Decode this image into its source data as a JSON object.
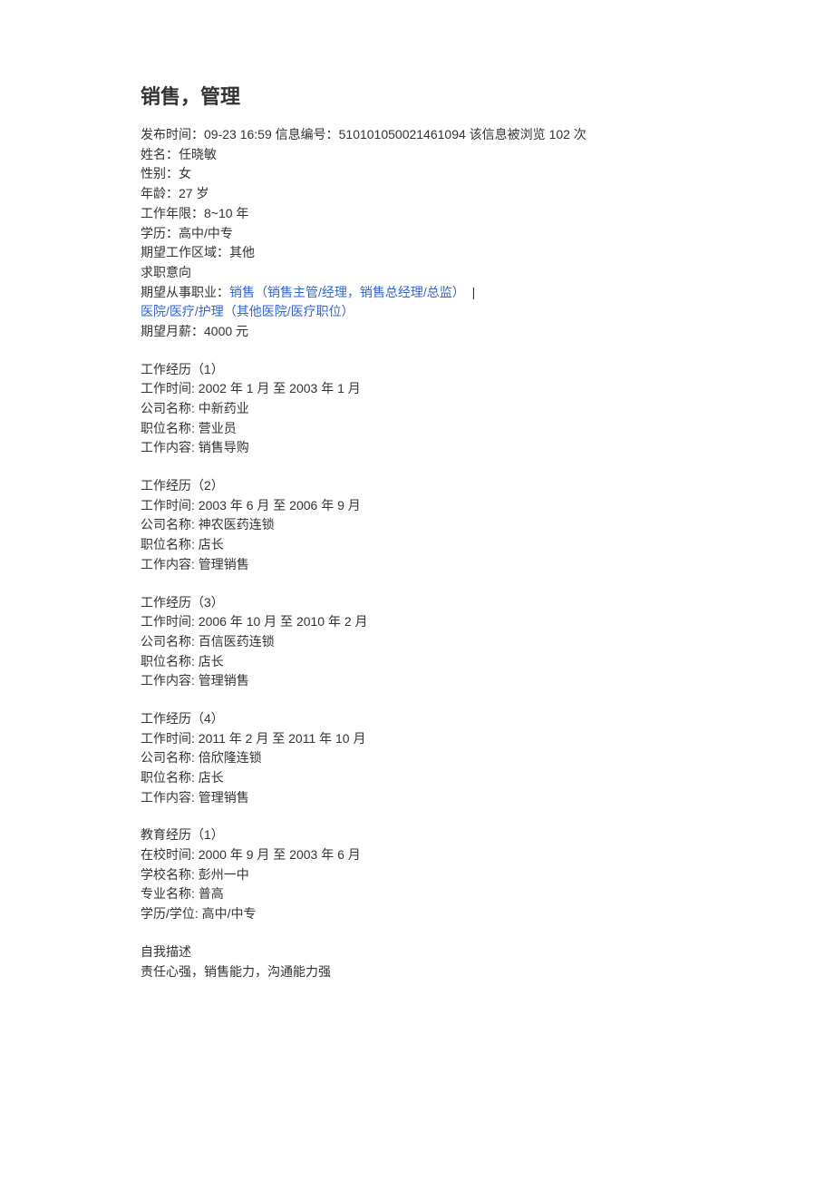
{
  "title": "销售，管理",
  "meta": {
    "publish_label": "发布时间：",
    "publish_value": "09-23 16:59",
    "info_id_label": " 信息编号：",
    "info_id_value": "510101050021461094",
    "view_prefix": " 该信息被浏览 ",
    "view_count": "102",
    "view_suffix": " 次"
  },
  "basic": {
    "name_label": "姓名：",
    "name": "任晓敏",
    "gender_label": "性别：",
    "gender": "女",
    "age_label": "年龄：",
    "age": "27 岁",
    "work_years_label": "工作年限：",
    "work_years": "8~10 年",
    "edu_label": "学历：",
    "edu": "高中/中专",
    "region_label": "期望工作区域：",
    "region": "其他",
    "intent_label": "求职意向",
    "occupation_label": "期望从事职业：",
    "occupation_link1": "销售（销售主管/经理，销售总经理/总监）",
    "occupation_sep": " | ",
    "occupation_link2": "医院/医疗/护理（其他医院/医疗职位）",
    "salary_label": "期望月薪：",
    "salary": "4000 元"
  },
  "work": [
    {
      "header": "工作经历（1）",
      "time_label": "工作时间: ",
      "time": "2002 年 1 月 至 2003 年 1 月",
      "company_label": "公司名称: ",
      "company": "中新药业",
      "position_label": "职位名称: ",
      "position": "营业员",
      "content_label": "工作内容: ",
      "content": "销售导购"
    },
    {
      "header": "工作经历（2）",
      "time_label": "工作时间: ",
      "time": "2003 年 6 月 至 2006 年 9 月",
      "company_label": "公司名称: ",
      "company": "神农医药连锁",
      "position_label": "职位名称: ",
      "position": "店长",
      "content_label": "工作内容: ",
      "content": "管理销售"
    },
    {
      "header": "工作经历（3）",
      "time_label": "工作时间: ",
      "time": "2006 年 10 月 至 2010 年 2 月",
      "company_label": "公司名称: ",
      "company": "百信医药连锁",
      "position_label": "职位名称: ",
      "position": "店长",
      "content_label": "工作内容: ",
      "content": "管理销售"
    },
    {
      "header": "工作经历（4）",
      "time_label": "工作时间: ",
      "time": "2011 年 2 月 至 2011 年 10 月",
      "company_label": "公司名称: ",
      "company": "倍欣隆连锁",
      "position_label": "职位名称: ",
      "position": "店长",
      "content_label": "工作内容: ",
      "content": "管理销售"
    }
  ],
  "education": [
    {
      "header": "教育经历（1）",
      "time_label": "在校时间: ",
      "time": "2000 年 9 月 至 2003 年 6 月",
      "school_label": "学校名称: ",
      "school": "彭州一中",
      "major_label": "专业名称: ",
      "major": "普高",
      "degree_label": "学历/学位: ",
      "degree": "高中/中专"
    }
  ],
  "self": {
    "header": "自我描述",
    "content": "责任心强，销售能力，沟通能力强"
  }
}
